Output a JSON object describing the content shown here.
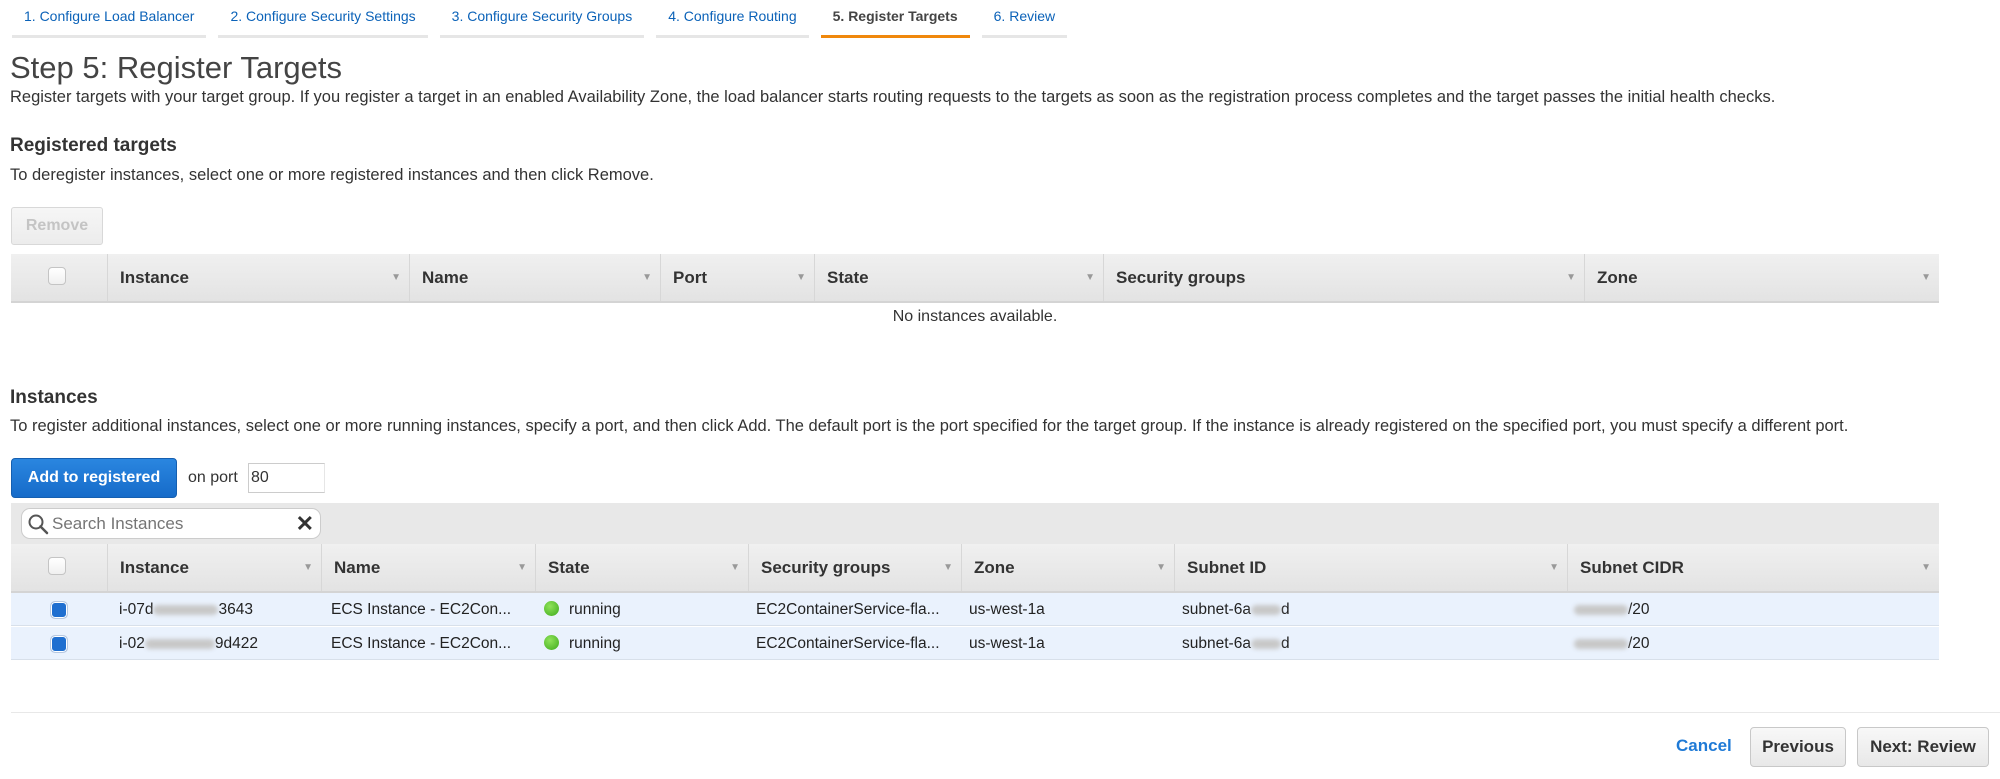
{
  "wizard_tabs": [
    {
      "label": "1. Configure Load Balancer",
      "active": false
    },
    {
      "label": "2. Configure Security Settings",
      "active": false
    },
    {
      "label": "3. Configure Security Groups",
      "active": false
    },
    {
      "label": "4. Configure Routing",
      "active": false
    },
    {
      "label": "5. Register Targets",
      "active": true
    },
    {
      "label": "6. Review",
      "active": false
    }
  ],
  "page": {
    "title": "Step 5: Register Targets",
    "description": "Register targets with your target group. If you register a target in an enabled Availability Zone, the load balancer starts routing requests to the targets as soon as the registration process completes and the target passes the initial health checks."
  },
  "registered": {
    "title": "Registered targets",
    "description": "To deregister instances, select one or more registered instances and then click Remove.",
    "remove_label": "Remove",
    "columns": [
      "Instance",
      "Name",
      "Port",
      "State",
      "Security groups",
      "Zone"
    ],
    "empty_message": "No instances available."
  },
  "instances": {
    "title": "Instances",
    "description": "To register additional instances, select one or more running instances, specify a port, and then click Add. The default port is the port specified for the target group. If the instance is already registered on the specified port, you must specify a different port.",
    "add_label": "Add to registered",
    "port_label": "on port",
    "port_value": "80",
    "search_placeholder": "Search Instances",
    "columns": [
      "Instance",
      "Name",
      "State",
      "Security groups",
      "Zone",
      "Subnet ID",
      "Subnet CIDR"
    ],
    "rows": [
      {
        "selected": true,
        "instance_prefix": "i-07d",
        "instance_suffix": "3643",
        "name": "ECS Instance - EC2Con...",
        "state": "running",
        "security_groups": "EC2ContainerService-fla...",
        "zone": "us-west-1a",
        "subnet_prefix": "subnet-6a",
        "subnet_suffix": "d",
        "cidr_suffix": "/20"
      },
      {
        "selected": true,
        "instance_prefix": "i-02",
        "instance_suffix": "9d422",
        "name": "ECS Instance - EC2Con...",
        "state": "running",
        "security_groups": "EC2ContainerService-fla...",
        "zone": "us-west-1a",
        "subnet_prefix": "subnet-6a",
        "subnet_suffix": "d",
        "cidr_suffix": "/20"
      }
    ]
  },
  "footer": {
    "cancel_label": "Cancel",
    "previous_label": "Previous",
    "next_label": "Next: Review"
  },
  "colors": {
    "accent": "#1f6fd0",
    "active_tab_underline": "#f0880c",
    "link": "#0b62b8",
    "running": "#3daa1c"
  }
}
